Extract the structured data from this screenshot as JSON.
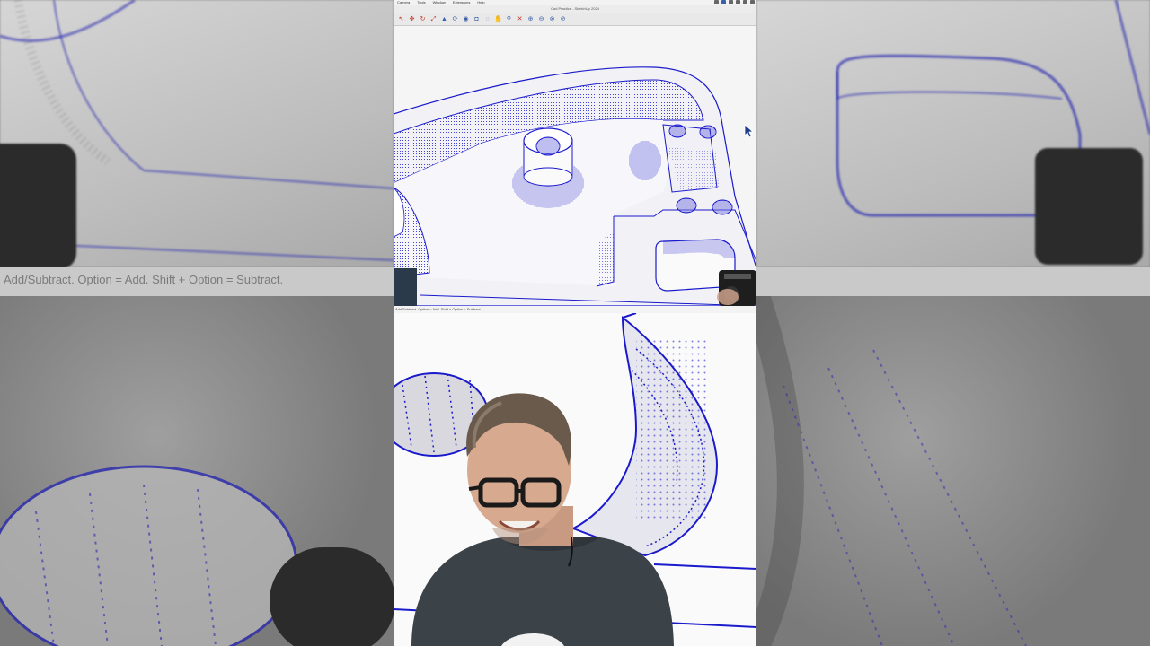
{
  "app": {
    "window_title": "Cad Practice - SketchUp 2024",
    "menus": [
      "Camera",
      "Tools",
      "Window",
      "Extensions",
      "Help"
    ]
  },
  "toolbar": {
    "tools": [
      {
        "name": "select-tool-icon",
        "glyph": "↖",
        "color": "#c0392b"
      },
      {
        "name": "move-tool-icon",
        "glyph": "✥",
        "color": "#c0392b"
      },
      {
        "name": "rotate-tool-icon",
        "glyph": "↻",
        "color": "#c0392b"
      },
      {
        "name": "scale-tool-icon",
        "glyph": "⤢",
        "color": "#c0392b"
      },
      {
        "name": "pushpull-tool-icon",
        "glyph": "▲",
        "color": "#3a5ea8"
      },
      {
        "name": "followme-tool-icon",
        "glyph": "⟳",
        "color": "#3a5ea8"
      },
      {
        "name": "offset-tool-icon",
        "glyph": "◉",
        "color": "#3a5ea8"
      },
      {
        "name": "tape-tool-icon",
        "glyph": "◘",
        "color": "#3a5ea8"
      },
      {
        "name": "orbit-tool-icon",
        "glyph": "◌",
        "color": "#3a5ea8"
      },
      {
        "name": "pan-tool-icon",
        "glyph": "✋",
        "color": "#c0392b"
      },
      {
        "name": "zoom-tool-icon",
        "glyph": "⚲",
        "color": "#3a5ea8"
      },
      {
        "name": "zoom-extents-icon",
        "glyph": "✕",
        "color": "#c0392b"
      },
      {
        "name": "solid-union-icon",
        "glyph": "⊕",
        "color": "#3a5ea8"
      },
      {
        "name": "solid-subtract-icon",
        "glyph": "⊖",
        "color": "#3a5ea8"
      },
      {
        "name": "solid-intersect-icon",
        "glyph": "⊗",
        "color": "#3a5ea8"
      },
      {
        "name": "solid-trim-icon",
        "glyph": "⊘",
        "color": "#3a5ea8"
      }
    ]
  },
  "status_bar": {
    "hint": "Add/Subtract. Option = Add. Shift + Option = Subtract."
  },
  "colors": {
    "edge_blue": "#1a1acc",
    "accent_red": "#c0392b"
  }
}
